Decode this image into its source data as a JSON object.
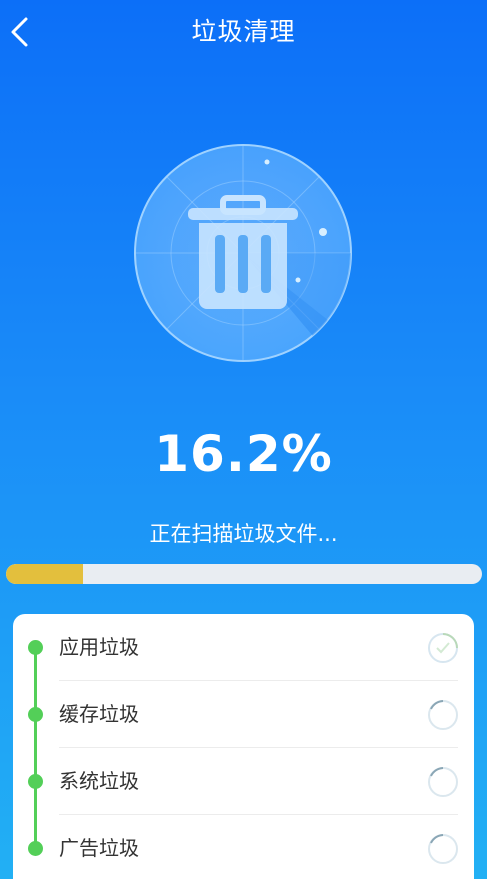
{
  "header": {
    "title": "垃圾清理",
    "back_icon": "chevron-left-icon"
  },
  "scan": {
    "percent_text": "16.2%",
    "progress": 0.162,
    "status_text": "正在扫描垃圾文件...",
    "progress_color": "#e3bf3d"
  },
  "categories": [
    {
      "label": "应用垃圾"
    },
    {
      "label": "缓存垃圾"
    },
    {
      "label": "系统垃圾"
    },
    {
      "label": "广告垃圾"
    }
  ],
  "colors": {
    "accent_green": "#53cf58",
    "bg_top": "#0c6ff8",
    "bg_bottom": "#22b0f4"
  }
}
